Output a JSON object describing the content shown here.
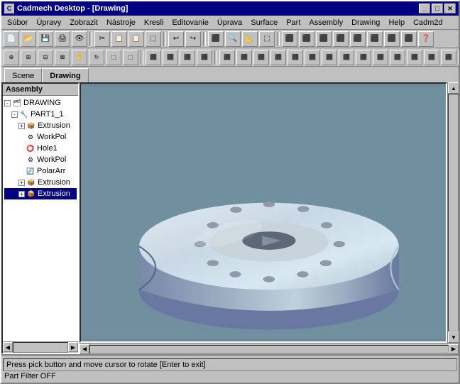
{
  "window": {
    "title": "Cadmech Desktop - [Drawing]",
    "icon": "C"
  },
  "menu": {
    "items": [
      "Súbor",
      "Úpravy",
      "Zobrazit",
      "Nástroje",
      "Kresli",
      "Editovanie",
      "Úprava",
      "Surface",
      "Part",
      "Assembly",
      "Drawing",
      "Help",
      "Cadm2d"
    ]
  },
  "toolbar1": {
    "buttons": [
      "📄",
      "💾",
      "🖨",
      "👁",
      "✂",
      "📋",
      "📋",
      "🔲",
      "↩",
      "↪",
      "⬛",
      "🔍",
      "📐",
      "🔲",
      "⬛",
      "⬛",
      "⬛",
      "⬛",
      "⬛",
      "⬛",
      "⬛",
      "⬛",
      "❓"
    ]
  },
  "toolbar2": {
    "buttons": [
      "🔍",
      "🔍",
      "🔍",
      "🔍",
      "🔍",
      "🔍",
      "🔍",
      "🔍",
      "⬛",
      "⬛",
      "⬛",
      "⬛",
      "⬛",
      "⬛",
      "⬛",
      "⬛",
      "⬛",
      "⬛",
      "⬛",
      "⬛",
      "⬛",
      "⬛",
      "⬛",
      "⬛",
      "⬛",
      "⬛",
      "⬛",
      "⬛",
      "⬛",
      "⬛"
    ]
  },
  "tabs": {
    "items": [
      "Scene",
      "Drawing"
    ],
    "active": "Drawing"
  },
  "left_panel": {
    "header": "Assembly",
    "tree": [
      {
        "label": "DRAWING",
        "level": 0,
        "icon": "🗂",
        "expanded": true
      },
      {
        "label": "PART1_1",
        "level": 1,
        "icon": "🔧",
        "expanded": true
      },
      {
        "label": "Extrusion",
        "level": 2,
        "icon": "📦",
        "expanded": false
      },
      {
        "label": "WorkPol",
        "level": 3,
        "icon": "⚙"
      },
      {
        "label": "Hole1",
        "level": 3,
        "icon": "⭕"
      },
      {
        "label": "WorkPol",
        "level": 3,
        "icon": "⚙"
      },
      {
        "label": "PolarArr",
        "level": 3,
        "icon": "🔄"
      },
      {
        "label": "Extrusion",
        "level": 2,
        "icon": "📦"
      },
      {
        "label": "Extrusion",
        "level": 2,
        "icon": "📦",
        "selected": true
      }
    ]
  },
  "status": {
    "line1": "Press pick button and move cursor to rotate [Enter to exit]",
    "line2": "Part Filter OFF"
  },
  "title_buttons": {
    "minimize": "_",
    "maximize": "□",
    "close": "✕"
  },
  "inner_title_buttons": {
    "minimize": "_",
    "maximize": "□",
    "close": "✕"
  },
  "colors": {
    "viewport_bg": "#7090a0",
    "disk_top": "#d0d8e0",
    "disk_side": "#8898a8",
    "disk_highlight": "#e8eef2",
    "window_blue": "#000080",
    "selected_blue": "#000080"
  }
}
